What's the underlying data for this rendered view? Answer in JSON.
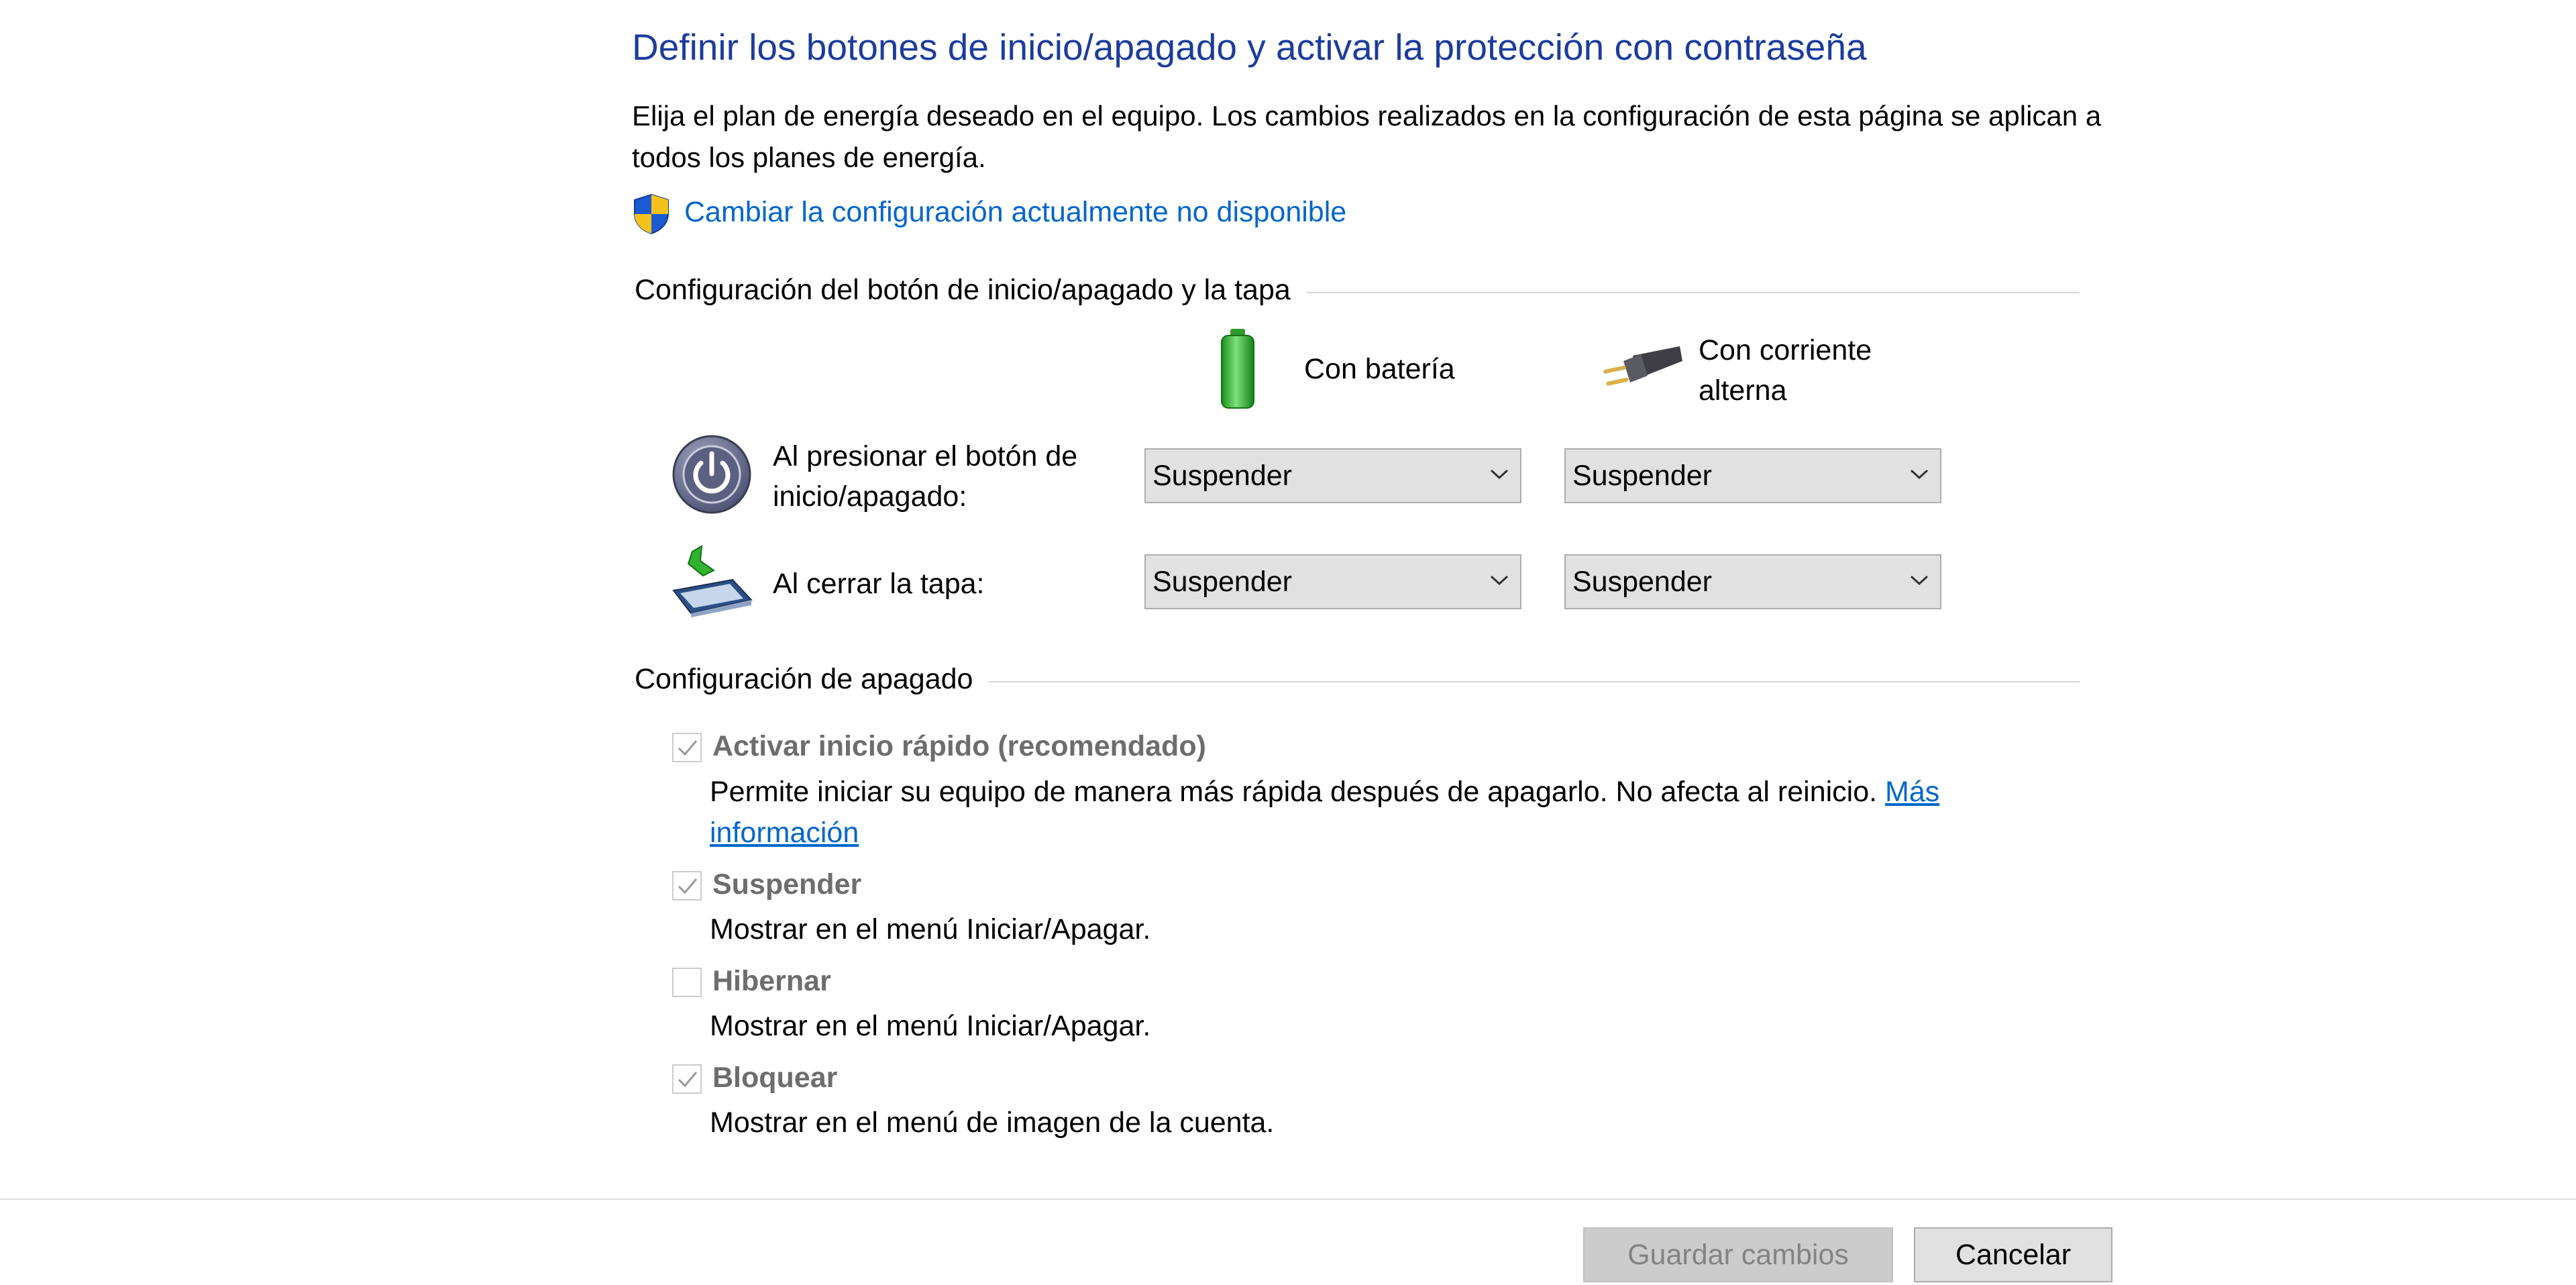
{
  "header": {
    "title": "Definir los botones de inicio/apagado y activar la protección con contraseña",
    "description": "Elija el plan de energía deseado en el equipo. Los cambios realizados en la configuración de esta página se aplican a todos los planes de energía.",
    "change_link": "Cambiar la configuración actualmente no disponible"
  },
  "power_buttons": {
    "section_label": "Configuración del botón de inicio/apagado y la tapa",
    "col_battery": "Con batería",
    "col_ac": "Con corriente alterna",
    "rows": [
      {
        "label": "Al presionar el botón de inicio/apagado:",
        "battery": "Suspender",
        "ac": "Suspender"
      },
      {
        "label": "Al cerrar la tapa:",
        "battery": "Suspender",
        "ac": "Suspender"
      }
    ]
  },
  "shutdown": {
    "section_label": "Configuración de apagado",
    "items": [
      {
        "title": "Activar inicio rápido (recomendado)",
        "desc": "Permite iniciar su equipo de manera más rápida después de apagarlo. No afecta al reinicio.",
        "more": "Más información",
        "checked": true
      },
      {
        "title": "Suspender",
        "desc": "Mostrar en el menú Iniciar/Apagar.",
        "checked": true
      },
      {
        "title": "Hibernar",
        "desc": "Mostrar en el menú Iniciar/Apagar.",
        "checked": false
      },
      {
        "title": "Bloquear",
        "desc": "Mostrar en el menú de imagen de la cuenta.",
        "checked": true
      }
    ]
  },
  "footer": {
    "save_label": "Guardar cambios",
    "cancel_label": "Cancelar"
  },
  "icons": {
    "shield": "uac-shield-icon",
    "battery": "battery-icon",
    "plug": "ac-plug-icon",
    "power": "power-button-icon",
    "lid": "laptop-lid-icon",
    "checkmark": "checkmark-icon",
    "chevron": "chevron-down-icon"
  },
  "colors": {
    "title": "#1c3c9c",
    "link": "#0066cc",
    "disabled_text": "#6d6d6d",
    "dropdown_bg": "#e1e1e1"
  }
}
